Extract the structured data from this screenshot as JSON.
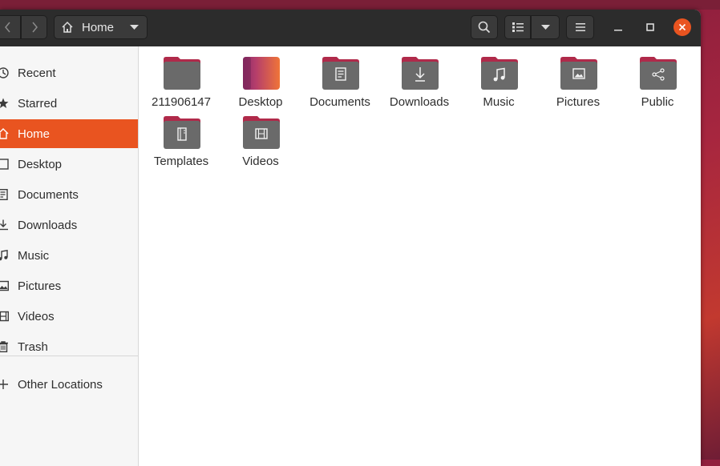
{
  "header": {
    "location": "Home",
    "icons": {
      "back": "chevron-left-icon",
      "forward": "chevron-right-icon",
      "home": "home-icon",
      "location_menu": "chevron-down-icon",
      "search": "search-icon",
      "view": "list-view-icon",
      "view_menu": "chevron-down-icon",
      "menu": "hamburger-menu-icon",
      "minimize": "minimize-icon",
      "maximize": "maximize-icon",
      "close": "close-icon"
    }
  },
  "sidebar": {
    "items": [
      {
        "label": "Recent",
        "icon": "clock-icon"
      },
      {
        "label": "Starred",
        "icon": "star-icon"
      },
      {
        "label": "Home",
        "icon": "home-icon",
        "active": true
      },
      {
        "label": "Desktop",
        "icon": "desktop-icon"
      },
      {
        "label": "Documents",
        "icon": "document-icon"
      },
      {
        "label": "Downloads",
        "icon": "download-icon"
      },
      {
        "label": "Music",
        "icon": "music-icon"
      },
      {
        "label": "Pictures",
        "icon": "picture-icon"
      },
      {
        "label": "Videos",
        "icon": "video-icon"
      },
      {
        "label": "Trash",
        "icon": "trash-icon"
      }
    ],
    "other_locations": {
      "label": "Other Locations",
      "icon": "plus-icon"
    }
  },
  "folders": [
    {
      "label": "211906147",
      "icon": "folder-icon"
    },
    {
      "label": "Desktop",
      "icon": "desktop-folder-icon"
    },
    {
      "label": "Documents",
      "icon": "documents-folder-icon"
    },
    {
      "label": "Downloads",
      "icon": "downloads-folder-icon"
    },
    {
      "label": "Music",
      "icon": "music-folder-icon"
    },
    {
      "label": "Pictures",
      "icon": "pictures-folder-icon"
    },
    {
      "label": "Public",
      "icon": "public-folder-icon"
    },
    {
      "label": "Templates",
      "icon": "templates-folder-icon"
    },
    {
      "label": "Videos",
      "icon": "videos-folder-icon"
    }
  ],
  "colors": {
    "accent": "#e95420",
    "headerbar": "#2c2c2c",
    "folder_body": "#6a6a6a",
    "folder_tab": "#b02a4a"
  }
}
